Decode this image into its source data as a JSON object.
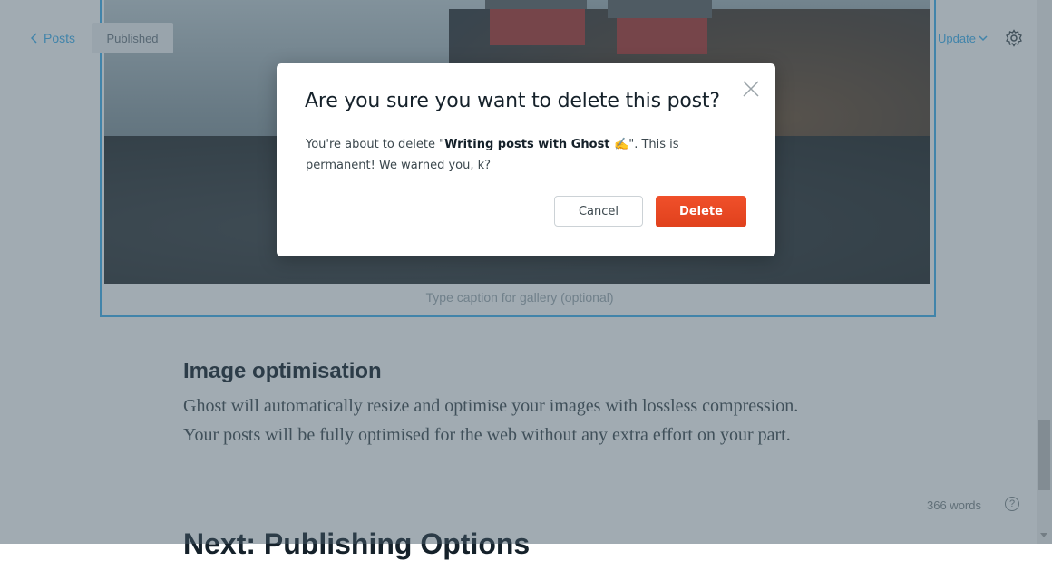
{
  "nav": {
    "back_label": "Posts",
    "status": "Published",
    "update_label": "Update"
  },
  "gallery": {
    "caption_placeholder": "Type caption for gallery (optional)"
  },
  "content": {
    "heading": "Image optimisation",
    "paragraph": "Ghost will automatically resize and optimise your images with lossless compression. Your posts will be fully optimised for the web without any extra effort on your part.",
    "next_heading": "Next: Publishing Options"
  },
  "footer": {
    "word_count": "366 words",
    "help_label": "?"
  },
  "modal": {
    "title": "Are you sure you want to delete this post?",
    "body_prefix": "You're about to delete \"",
    "post_title": "Writing posts with Ghost ✍️",
    "body_suffix": "\". This is permanent! We warned you, k?",
    "cancel_label": "Cancel",
    "delete_label": "Delete"
  },
  "colors": {
    "accent": "#3eb0ef",
    "danger": "#e0411d",
    "overlay": "#445866"
  }
}
